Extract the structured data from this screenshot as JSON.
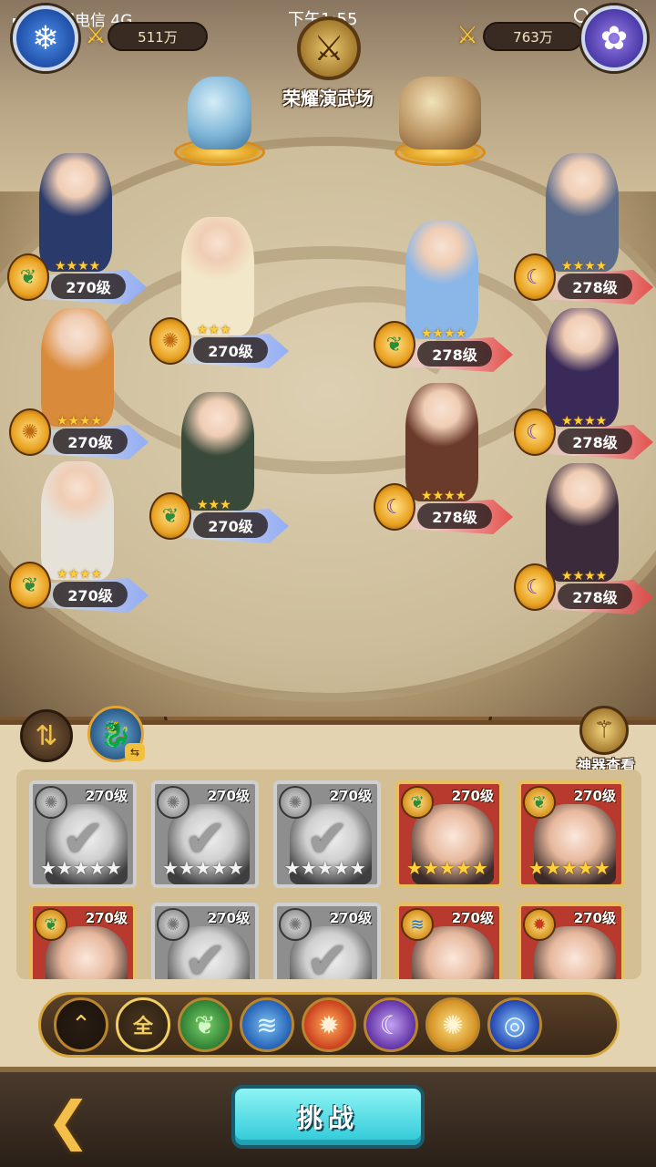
{
  "status_bar": {
    "carrier": "中国电信  4G",
    "time": "下午1:55"
  },
  "header": {
    "left_power": "511万",
    "right_power": "763万",
    "title": "荣耀演武场"
  },
  "left_team": [
    {
      "level": "270级",
      "stars": "★★★★",
      "faction_icon": "nature",
      "glyph": "❦"
    },
    {
      "level": "270级",
      "stars": "★★★★",
      "faction_icon": "light",
      "glyph": "✺"
    },
    {
      "level": "270级",
      "stars": "★★★★",
      "faction_icon": "nature",
      "glyph": "❦"
    },
    {
      "level": "270级",
      "stars": "★★★",
      "faction_icon": "light",
      "glyph": "✺"
    },
    {
      "level": "270级",
      "stars": "★★★",
      "faction_icon": "nature",
      "glyph": "❦"
    }
  ],
  "right_team": [
    {
      "level": "278级",
      "stars": "★★★★",
      "faction_icon": "moon",
      "glyph": "☾"
    },
    {
      "level": "278级",
      "stars": "★★★★",
      "faction_icon": "nature",
      "glyph": "❦"
    },
    {
      "level": "278级",
      "stars": "★★★★",
      "faction_icon": "moon",
      "glyph": "☾"
    },
    {
      "level": "278级",
      "stars": "★★★★",
      "faction_icon": "moon",
      "glyph": "☾"
    },
    {
      "level": "278级",
      "stars": "★★★★",
      "faction_icon": "moon",
      "glyph": "☾"
    }
  ],
  "artifact_label": "神器查看",
  "roster": [
    {
      "level": "270级",
      "stars": "★★★★★",
      "used": true
    },
    {
      "level": "270级",
      "stars": "★★★★★",
      "used": true
    },
    {
      "level": "270级",
      "stars": "★★★★★",
      "used": true
    },
    {
      "level": "270级",
      "stars": "★★★★★",
      "used": false
    },
    {
      "level": "270级",
      "stars": "★★★★★",
      "used": false
    },
    {
      "level": "270级",
      "stars": "",
      "used": false
    },
    {
      "level": "270级",
      "stars": "",
      "used": true
    },
    {
      "level": "270级",
      "stars": "",
      "used": true
    },
    {
      "level": "270级",
      "stars": "",
      "used": false
    },
    {
      "level": "270级",
      "stars": "",
      "used": false
    }
  ],
  "filter": {
    "all_label": "全"
  },
  "footer": {
    "challenge_label": "挑战"
  }
}
